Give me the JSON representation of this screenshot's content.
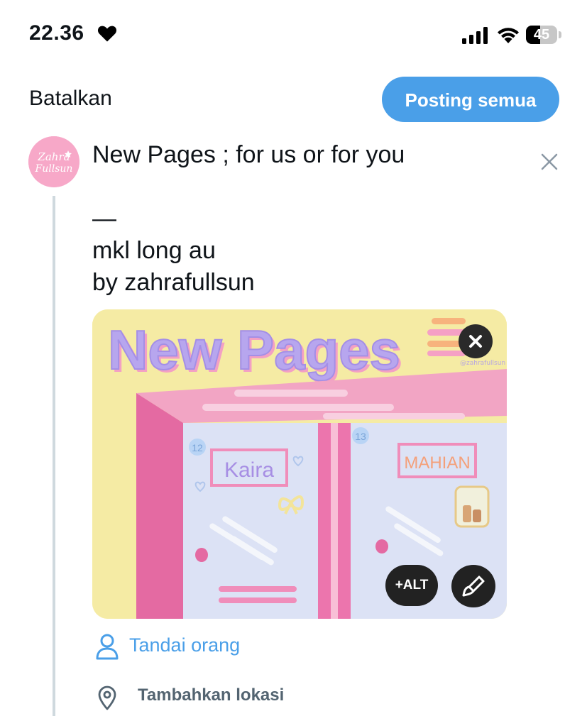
{
  "status_bar": {
    "time": "22.36",
    "battery_level": 45,
    "battery_text": "45"
  },
  "top_bar": {
    "cancel_label": "Batalkan",
    "post_all_label": "Posting semua"
  },
  "composer": {
    "avatar_text_line1": "Zahra",
    "avatar_text_line2": "Fullsun",
    "text": "New Pages ; for us or for you\n\n—\nmkl long au\nby zahrafullsun",
    "close_icon": "close-icon"
  },
  "media": {
    "image_title": "New Pages",
    "watermark": "@zahrafullsun",
    "locker_left_name": "Kaira",
    "locker_left_number": "12",
    "locker_right_name": "MAHIAN",
    "locker_right_number": "13",
    "alt_label": "+ALT",
    "remove_icon": "close-icon",
    "edit_icon": "brush-icon"
  },
  "actions": {
    "tag_people_label": "Tandai orang",
    "add_location_label": "Tambahkan lokasi"
  },
  "colors": {
    "accent": "#4a9fe8",
    "secondary_text": "#536471"
  }
}
